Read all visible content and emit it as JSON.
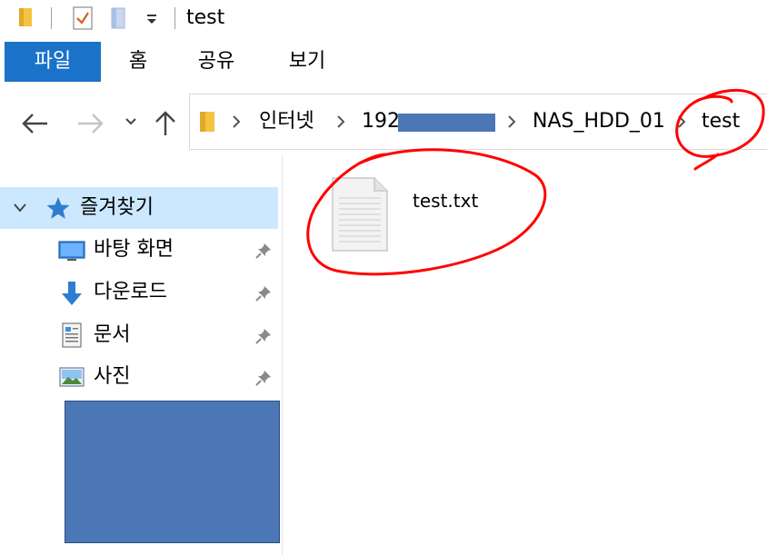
{
  "window": {
    "title": "test"
  },
  "ribbon": {
    "tabs": [
      {
        "label": "파일",
        "active": true
      },
      {
        "label": "홈"
      },
      {
        "label": "공유"
      },
      {
        "label": "보기"
      }
    ]
  },
  "address": {
    "crumbs": [
      "인터넷",
      "192",
      "NAS_HDD_01",
      "test"
    ]
  },
  "nav_pane": {
    "quick_access": "즐겨찾기",
    "items": [
      {
        "label": "바탕 화면",
        "icon": "desktop-icon",
        "pinned": true
      },
      {
        "label": "다운로드",
        "icon": "download-icon",
        "pinned": true
      },
      {
        "label": "문서",
        "icon": "documents-icon",
        "pinned": true
      },
      {
        "label": "사진",
        "icon": "pictures-icon",
        "pinned": true
      }
    ]
  },
  "content": {
    "files": [
      {
        "name": "test.txt",
        "icon": "text-file-icon"
      }
    ]
  },
  "colors": {
    "accent": "#1a73c9",
    "selected": "#cce8ff",
    "redaction": "#4b77b6",
    "annotation": "#ff0000",
    "folder": "#f5c342"
  }
}
